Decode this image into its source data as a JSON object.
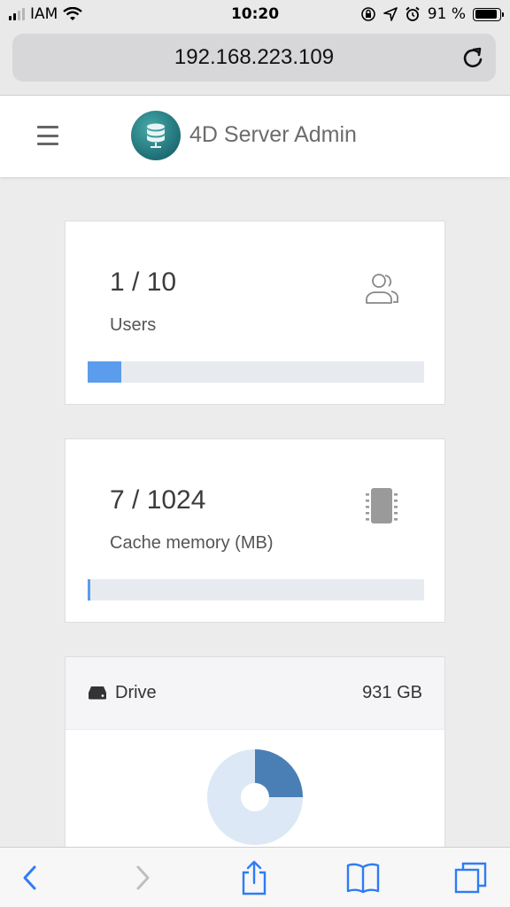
{
  "status_bar": {
    "carrier": "IAM",
    "time": "10:20",
    "battery": "91 %",
    "battery_level": 0.91
  },
  "browser": {
    "url": "192.168.223.109"
  },
  "header": {
    "title": "4D Server Admin"
  },
  "users_card": {
    "value": "1 / 10",
    "label": "Users",
    "progress": 0.1,
    "icon": "users-icon"
  },
  "cache_card": {
    "value": "7 / 1024",
    "label": "Cache memory (MB)",
    "progress": 0.007,
    "icon": "memory-chip-icon"
  },
  "drive_card": {
    "label": "Drive",
    "size": "931 GB",
    "used_fraction": 0.25
  },
  "colors": {
    "accent": "#5b9ced",
    "donut_used": "#4a7fb5",
    "donut_free": "#dce8f5",
    "logo": "#1e6e75"
  },
  "toolbar": {
    "icons": [
      "back-icon",
      "forward-icon",
      "share-icon",
      "bookmarks-icon",
      "tabs-icon"
    ]
  }
}
